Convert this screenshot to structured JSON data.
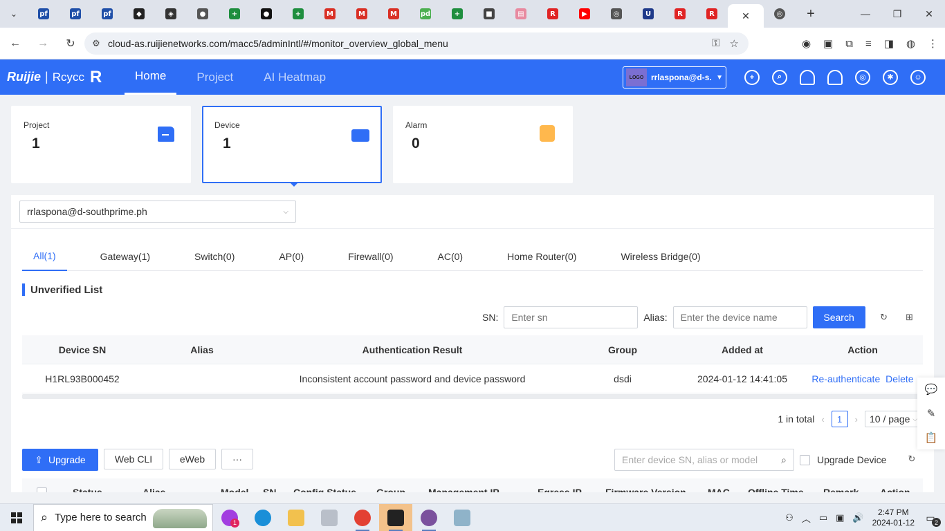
{
  "browser": {
    "url": "cloud-as.ruijienetworks.com/macc5/adminIntl/#/monitor_overview_global_menu",
    "tabs": [
      {
        "icon": "pf-icon",
        "glyph": "pf",
        "color": "#1f4fa8"
      },
      {
        "icon": "pf-icon",
        "glyph": "pf",
        "color": "#1f4fa8"
      },
      {
        "icon": "pf-icon",
        "glyph": "pf",
        "color": "#1f4fa8"
      },
      {
        "icon": "box-icon",
        "glyph": "◆",
        "color": "#222222"
      },
      {
        "icon": "eye-icon",
        "glyph": "◈",
        "color": "#333333"
      },
      {
        "icon": "globe-icon",
        "glyph": "●",
        "color": "#555555"
      },
      {
        "icon": "sheets-icon",
        "glyph": "+",
        "color": "#1e8e3e"
      },
      {
        "icon": "github-icon",
        "glyph": "●",
        "color": "#111111"
      },
      {
        "icon": "sheets-icon",
        "glyph": "+",
        "color": "#1e8e3e"
      },
      {
        "icon": "gmail-icon",
        "glyph": "M",
        "color": "#d93025"
      },
      {
        "icon": "gmail-icon",
        "glyph": "M",
        "color": "#d93025"
      },
      {
        "icon": "gmail-icon",
        "glyph": "M",
        "color": "#d93025"
      },
      {
        "icon": "pd-icon",
        "glyph": "pd",
        "color": "#4caf50"
      },
      {
        "icon": "sheets-icon",
        "glyph": "+",
        "color": "#1e8e3e"
      },
      {
        "icon": "cube-icon",
        "glyph": "■",
        "color": "#444444"
      },
      {
        "icon": "photo-icon",
        "glyph": "▤",
        "color": "#e88aa0"
      },
      {
        "icon": "ruijie-r-icon",
        "glyph": "R",
        "color": "#e02424"
      },
      {
        "icon": "youtube-icon",
        "glyph": "▶",
        "color": "#ff0000"
      },
      {
        "icon": "chrome-icon",
        "glyph": "◎",
        "color": "#555555"
      },
      {
        "icon": "shield-icon",
        "glyph": "U",
        "color": "#1f3a8a"
      },
      {
        "icon": "ruijie-r-icon",
        "glyph": "R",
        "color": "#e02424"
      },
      {
        "icon": "ruijie-r-icon",
        "glyph": "R",
        "color": "#e02424"
      }
    ],
    "active_tab_close": "✕",
    "after_tabs": {
      "icon": "chrome-icon",
      "glyph": "◎",
      "color": "#555555"
    },
    "new_tab": "+",
    "win_min": "—",
    "win_max": "❐",
    "win_close": "✕"
  },
  "app": {
    "logo_ruijie": "Ruijie",
    "logo_sep": "|",
    "logo_rcycc": "Rcycc",
    "logo_mark": "R",
    "nav": [
      "Home",
      "Project",
      "AI Heatmap"
    ],
    "account_logo": "LOGO",
    "account_name": "rrlaspona@d-s..."
  },
  "cards": {
    "project": {
      "label": "Project",
      "value": "1"
    },
    "device": {
      "label": "Device",
      "value": "1"
    },
    "alarm": {
      "label": "Alarm",
      "value": "0"
    }
  },
  "panel": {
    "account_dropdown": "rrlaspona@d-southprime.ph",
    "tabs": [
      "All(1)",
      "Gateway(1)",
      "Switch(0)",
      "AP(0)",
      "Firewall(0)",
      "AC(0)",
      "Home Router(0)",
      "Wireless Bridge(0)"
    ],
    "unverified_title": "Unverified List",
    "sn_label": "SN:",
    "sn_placeholder": "Enter sn",
    "alias_label": "Alias:",
    "alias_placeholder": "Enter the device name",
    "search_button": "Search",
    "table": {
      "headers": [
        "Device SN",
        "Alias",
        "Authentication Result",
        "Group",
        "Added at",
        "Action"
      ],
      "rows": [
        {
          "sn": "H1RL93B000452",
          "alias": "",
          "result": "Inconsistent account password and device password",
          "group": "dsdi",
          "added": "2024-01-12 14:41:05",
          "action_reauth": "Re-authenticate",
          "action_delete": "Delete"
        }
      ]
    },
    "pager": {
      "total": "1 in total",
      "page": "1",
      "size": "10 / page"
    },
    "actions": {
      "upgrade": "Upgrade",
      "webcli": "Web CLI",
      "eweb": "eWeb",
      "more": "···",
      "device_search_placeholder": "Enter device SN, alias or model",
      "upgrade_device": "Upgrade Device"
    },
    "device_table_headers": [
      "Status",
      "Alias",
      "Model",
      "SN",
      "Config Status",
      "Group",
      "Management IP",
      "Egress IP",
      "Firmware Version",
      "MAC",
      "Offline Time",
      "Remark",
      "Action"
    ]
  },
  "taskbar": {
    "search_text": "Type here to search",
    "time": "2:47 PM",
    "date": "2024-01-12",
    "notifications": "2",
    "messenger_badge": "1"
  }
}
